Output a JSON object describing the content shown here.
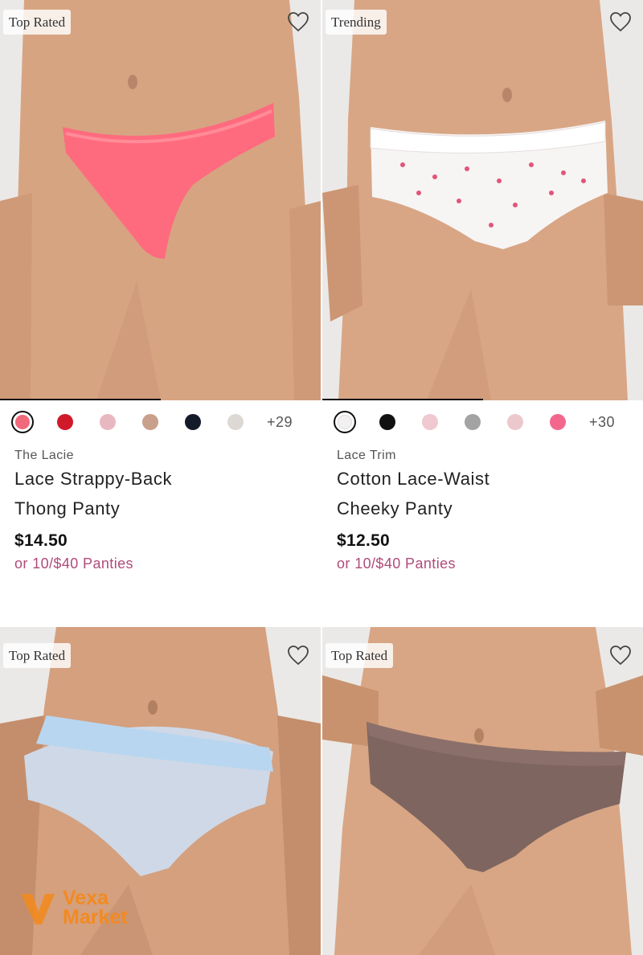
{
  "products": [
    {
      "badge": "Top Rated",
      "collection": "The Lacie",
      "name_line1": "Lace Strappy-Back",
      "name_line2": "Thong Panty",
      "price": "$14.50",
      "promo": "or 10/$40 Panties",
      "more_colors": "+29",
      "image_progress": 0.5,
      "swatches": [
        "#f06a7c",
        "#d01a2a",
        "#e8b8c0",
        "#c9a08c",
        "#151a2a",
        "#ddd8d4"
      ],
      "product_color": "#ff6b7e"
    },
    {
      "badge": "Trending",
      "collection": "Lace Trim",
      "name_line1": "Cotton Lace-Waist",
      "name_line2": "Cheeky Panty",
      "price": "$12.50",
      "promo": "or 10/$40 Panties",
      "more_colors": "+30",
      "image_progress": 0.5,
      "swatches": [
        "#f2f0f0",
        "#111111",
        "#f0c8d0",
        "#a3a3a3",
        "#ecc8cc",
        "#f2688c"
      ],
      "product_color": "#f7f4f4"
    },
    {
      "badge": "Top Rated",
      "product_color": "#cfd8e6",
      "waistband_color": "#b9d6f0"
    },
    {
      "badge": "Top Rated",
      "product_color": "#7e6560",
      "waistband_color": "#8b6f6a"
    }
  ],
  "icons": {
    "wishlist": "heart-outline-icon",
    "watermark_logo": "vexa-logo-icon"
  },
  "watermark": {
    "line1": "Vexa",
    "line2": "Market"
  },
  "colors": {
    "promo": "#b04b7a",
    "skin": "#d9a684",
    "watermark": "#f28a21"
  }
}
